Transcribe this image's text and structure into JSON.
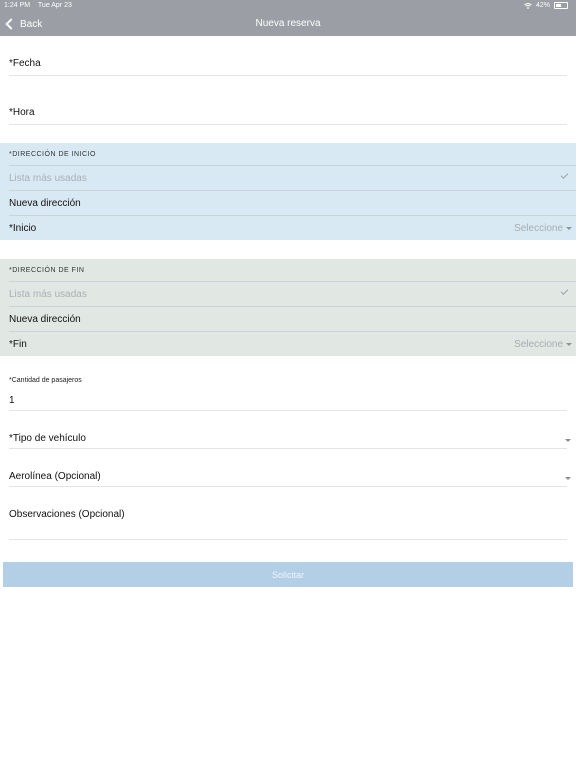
{
  "status_bar": {
    "time": "1:24 PM",
    "date": "Tue Apr 23",
    "battery": "42%"
  },
  "nav": {
    "back_label": "Back",
    "title": "Nueva reserva"
  },
  "form": {
    "fecha_label": "*Fecha",
    "hora_label": "*Hora",
    "start": {
      "header": "*DIRECCIÓN DE INICIO",
      "frequent": "Lista más usadas",
      "new": "Nueva dirección",
      "field_label": "*Inicio",
      "placeholder": "Seleccione"
    },
    "end": {
      "header": "*DIRECCIÓN DE FIN",
      "frequent": "Lista más usadas",
      "new": "Nueva dirección",
      "field_label": "*Fin",
      "placeholder": "Seleccione"
    },
    "passengers_label": "*Cantidad de pasajeros",
    "passengers_value": "1",
    "vehicle_label": "*Tipo de vehículo",
    "airline_label": "Aerolínea (Opcional)",
    "notes_label": "Observaciones (Opcional)",
    "submit_label": "Solicitar"
  },
  "colors": {
    "nav_bg": "#9b9ea4",
    "start_section_bg": "#d9e9f3",
    "end_section_bg": "#e1e7e3",
    "submit_bg": "#b3cfe6"
  }
}
